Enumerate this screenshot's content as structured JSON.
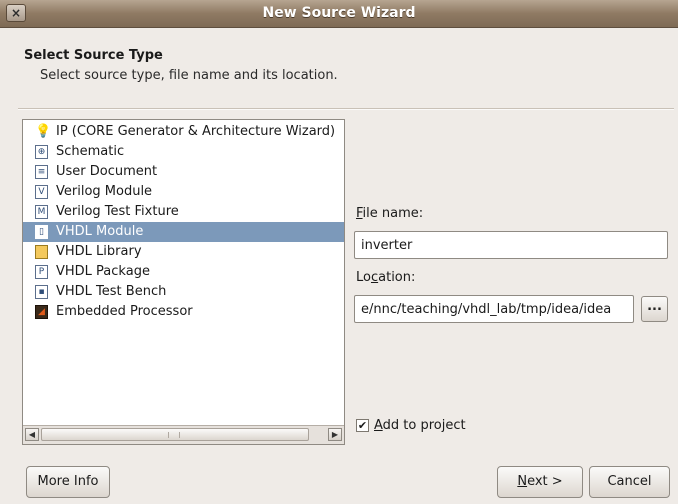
{
  "window": {
    "title": "New Source Wizard",
    "close_label": "×"
  },
  "header": {
    "title": "Select Source Type",
    "subtitle": "Select source type, file name and its location."
  },
  "source_types": [
    {
      "label": "IP (CORE Generator & Architecture Wizard)",
      "icon": "lightbulb-icon",
      "glyph": "💡",
      "selected": false
    },
    {
      "label": "Schematic",
      "icon": "schematic-icon",
      "glyph": "⊕",
      "selected": false
    },
    {
      "label": "User Document",
      "icon": "document-icon",
      "glyph": "≡",
      "selected": false
    },
    {
      "label": "Verilog Module",
      "icon": "verilog-module-icon",
      "glyph": "V",
      "selected": false
    },
    {
      "label": "Verilog Test Fixture",
      "icon": "verilog-test-fixture-icon",
      "glyph": "M",
      "selected": false
    },
    {
      "label": "VHDL Module",
      "icon": "vhdl-module-icon",
      "glyph": "▯",
      "selected": true
    },
    {
      "label": "VHDL Library",
      "icon": "vhdl-library-icon",
      "glyph": "",
      "selected": false
    },
    {
      "label": "VHDL Package",
      "icon": "vhdl-package-icon",
      "glyph": "P",
      "selected": false
    },
    {
      "label": "VHDL Test Bench",
      "icon": "vhdl-test-bench-icon",
      "glyph": "▪",
      "selected": false
    },
    {
      "label": "Embedded Processor",
      "icon": "embedded-processor-icon",
      "glyph": "◢",
      "selected": false
    }
  ],
  "form": {
    "file_name_label_prefix": "F",
    "file_name_label_rest": "ile name:",
    "file_name_value": "inverter",
    "location_label_prefix": "Lo",
    "location_label_key": "c",
    "location_label_rest": "ation:",
    "location_value": "e/nnc/teaching/vhdl_lab/tmp/idea/idea",
    "browse_label": "...",
    "add_to_project_key": "A",
    "add_to_project_rest": "dd to project",
    "add_to_project_checked": true,
    "check_mark": "✔"
  },
  "buttons": {
    "more_info": "More Info",
    "next": "Next >",
    "cancel": "Cancel"
  },
  "colors": {
    "selection": "#7c99ba",
    "titlebar": "#8f7a63",
    "background": "#efebe7"
  }
}
